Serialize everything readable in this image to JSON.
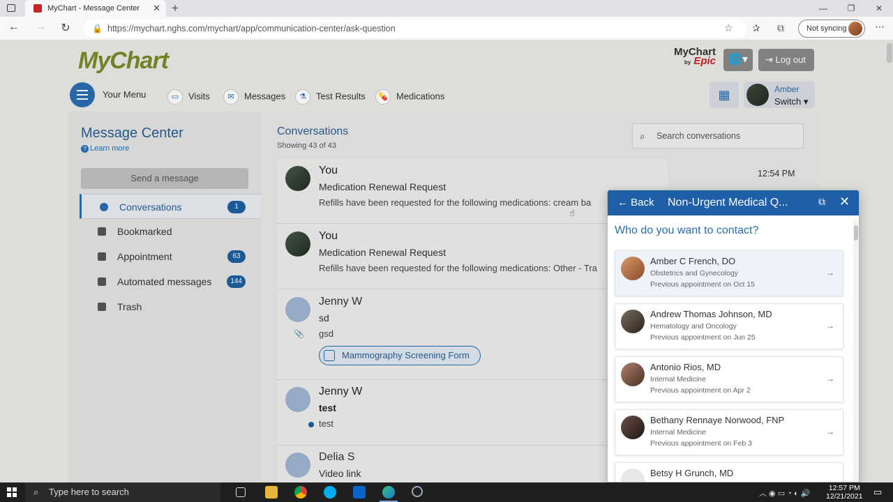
{
  "browser": {
    "tab_title": "MyChart - Message Center",
    "url": "https://mychart.nghs.com/mychart/app/communication-center/ask-question",
    "sync_label": "Not syncing"
  },
  "header": {
    "logo": "MyChart",
    "brand_top": "MyChart",
    "brand_by": "by",
    "brand_epic": "Epic",
    "logout_label": "Log out",
    "user_name": "Amber",
    "switch_label": "Switch"
  },
  "nav": {
    "menu_label": "Your Menu",
    "items": [
      {
        "label": "Visits"
      },
      {
        "label": "Messages"
      },
      {
        "label": "Test Results"
      },
      {
        "label": "Medications"
      }
    ]
  },
  "sidebar": {
    "title": "Message Center",
    "learn_more": "Learn more",
    "send_button": "Send a message",
    "folders": [
      {
        "label": "Conversations",
        "badge": "1"
      },
      {
        "label": "Bookmarked",
        "badge": ""
      },
      {
        "label": "Appointment",
        "badge": "63"
      },
      {
        "label": "Automated messages",
        "badge": "144"
      },
      {
        "label": "Trash",
        "badge": ""
      }
    ]
  },
  "conversations": {
    "title": "Conversations",
    "count": "Showing 43 of 43",
    "search_placeholder": "Search conversations",
    "items": [
      {
        "from": "You",
        "subject": "Medication Renewal Request",
        "preview": "Refills have been requested for the following medications:  cream ba",
        "time": "12:54 PM"
      },
      {
        "from": "You",
        "subject": "Medication Renewal Request",
        "preview": "Refills have been requested for the following medications: Other - Tra",
        "time": ""
      },
      {
        "from": "Jenny W",
        "subject": "sd",
        "preview": "gsd",
        "attachment": "Mammography Screening Form",
        "time": ""
      },
      {
        "from": "Jenny W",
        "subject": "test",
        "preview": "test",
        "time": ""
      },
      {
        "from": "Delia S",
        "subject": "Video link",
        "preview": "",
        "time": ""
      }
    ]
  },
  "modal": {
    "back_label": "Back",
    "title": "Non-Urgent Medical Q...",
    "question": "Who do you want to contact?",
    "providers": [
      {
        "name": "Amber C French, DO",
        "specialty": "Obstetrics and Gynecology",
        "appt": "Previous appointment on Oct 15"
      },
      {
        "name": "Andrew Thomas Johnson, MD",
        "specialty": "Hematology and Oncology",
        "appt": "Previous appointment on Jun 25"
      },
      {
        "name": "Antonio Rios, MD",
        "specialty": "Internal Medicine",
        "appt": "Previous appointment on Apr 2"
      },
      {
        "name": "Bethany Rennaye Norwood, FNP",
        "specialty": "Internal Medicine",
        "appt": "Previous appointment on Feb 3"
      },
      {
        "name": "Betsy H Grunch, MD",
        "specialty": "",
        "appt": ""
      }
    ]
  },
  "taskbar": {
    "search_placeholder": "Type here to search",
    "time": "12:57 PM",
    "date": "12/21/2021"
  },
  "colors": {
    "brand_blue": "#1e5fa8",
    "mychart_green": "#7b8a2a",
    "epic_red": "#c8252a"
  }
}
